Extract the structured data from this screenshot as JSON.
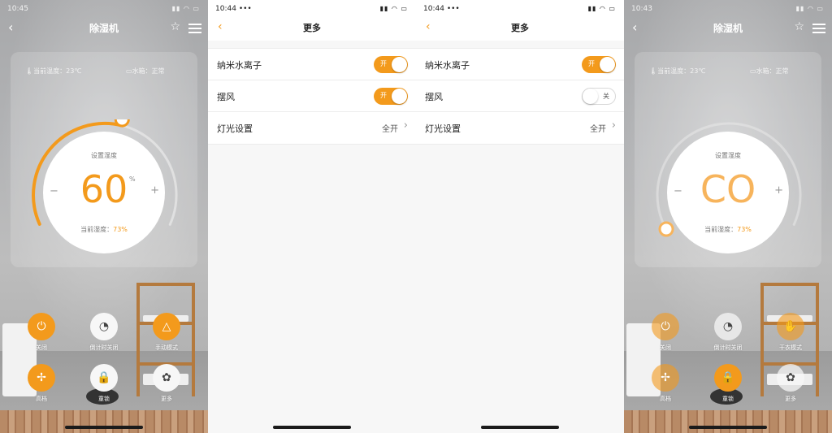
{
  "screens": {
    "main_on": {
      "status_time": "10:45",
      "status_icons": "▮▮ ◠ ▭",
      "title": "除湿机",
      "temp_label": "当前温度：23℃",
      "tank_label": "水箱：正常",
      "dial_label": "设置湿度",
      "dial_value": "60",
      "dial_unit": "%",
      "current_label": "当前湿度：",
      "current_value": "73%",
      "buttons": {
        "power": "关闭",
        "timer": "倒计时关闭",
        "mode": "手动模式",
        "fan": "高档",
        "lock": "童锁",
        "more": "更多"
      }
    },
    "more_1": {
      "status_time": "10:44",
      "status_dots": "•••",
      "status_icons": "▮▮ ◠ ▭",
      "title": "更多",
      "rows": [
        {
          "label": "纳米水离子",
          "toggle": "开"
        },
        {
          "label": "摆风",
          "toggle": "开"
        },
        {
          "label": "灯光设置",
          "value": "全开"
        }
      ]
    },
    "more_2": {
      "status_time": "10:44",
      "status_dots": "•••",
      "status_icons": "▮▮ ◠ ▭",
      "title": "更多",
      "rows": [
        {
          "label": "纳米水离子",
          "toggle": "开"
        },
        {
          "label": "摆风",
          "toggle": "关"
        },
        {
          "label": "灯光设置",
          "value": "全开"
        }
      ]
    },
    "main_co": {
      "status_time": "10:43",
      "status_icons": "▮▮ ◠ ▭",
      "title": "除湿机",
      "temp_label": "当前温度：23℃",
      "tank_label": "水箱：正常",
      "dial_label": "设置湿度",
      "dial_value": "CO",
      "current_label": "当前湿度：",
      "current_value": "73%",
      "buttons": {
        "power": "关闭",
        "timer": "倒计时关闭",
        "mode": "干衣模式",
        "fan": "高档",
        "lock": "童锁",
        "more": "更多"
      }
    }
  },
  "colors": {
    "accent": "#f39a1c",
    "ring_track": "#e6e6e6",
    "background_settings": "#f7f7f7"
  },
  "icons": [
    "back-icon",
    "star-icon",
    "settings-sliders-icon",
    "power-icon",
    "timer-icon",
    "mode-icon",
    "fan-icon",
    "lock-icon",
    "more-icon",
    "chevron-right-icon",
    "thermometer-icon",
    "water-tank-icon",
    "hand-icon"
  ],
  "humidity_setpoint_fraction": 0.62
}
